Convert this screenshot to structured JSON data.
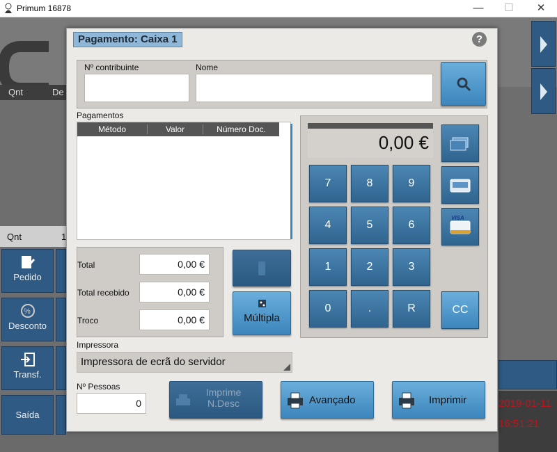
{
  "window": {
    "title": "Primum 16878",
    "minimize": "—",
    "maximize": "☐",
    "close": "✕"
  },
  "background": {
    "col_qnt": "Qnt",
    "col_des": "De",
    "qnt_label": "Qnt",
    "qnt_value": "1",
    "tiles": [
      "Pedido",
      "Desconto",
      "Transf.",
      "Saída"
    ],
    "date": "2019-01-11",
    "time": "16:51:21"
  },
  "dialog": {
    "title": "Pagamento: Caixa 1",
    "help": "?",
    "contribuinte_label": "Nº contribuinte",
    "contribuinte_value": "",
    "nome_label": "Nome",
    "nome_value": "",
    "pagamentos_label": "Pagamentos",
    "table_headers": [
      "Método",
      "Valor",
      "Número Doc."
    ],
    "total_label": "Total",
    "total_value": "0,00 €",
    "recebido_label": "Total recebido",
    "recebido_value": "0,00 €",
    "troco_label": "Troco",
    "troco_value": "0,00 €",
    "multipla_label": "Múltipla",
    "display_value": "0,00 €",
    "keys": [
      "7",
      "8",
      "9",
      "4",
      "5",
      "6",
      "1",
      "2",
      "3",
      "0",
      ".",
      "R"
    ],
    "cc_label": "CC",
    "visa_label": "VISA",
    "impressora_label": "Impressora",
    "impressora_value": "Impressora de ecrã do servidor",
    "pessoas_label": "Nº Pessoas",
    "pessoas_value": "0",
    "imprime_ndesc_line1": "Imprime",
    "imprime_ndesc_line2": "N.Desc",
    "avancado_label": "Avançado",
    "imprimir_label": "Imprimir"
  },
  "colors": {
    "accent": "#3c86bd",
    "title_bg": "#8fb7d8",
    "date_red": "#c0141c"
  }
}
